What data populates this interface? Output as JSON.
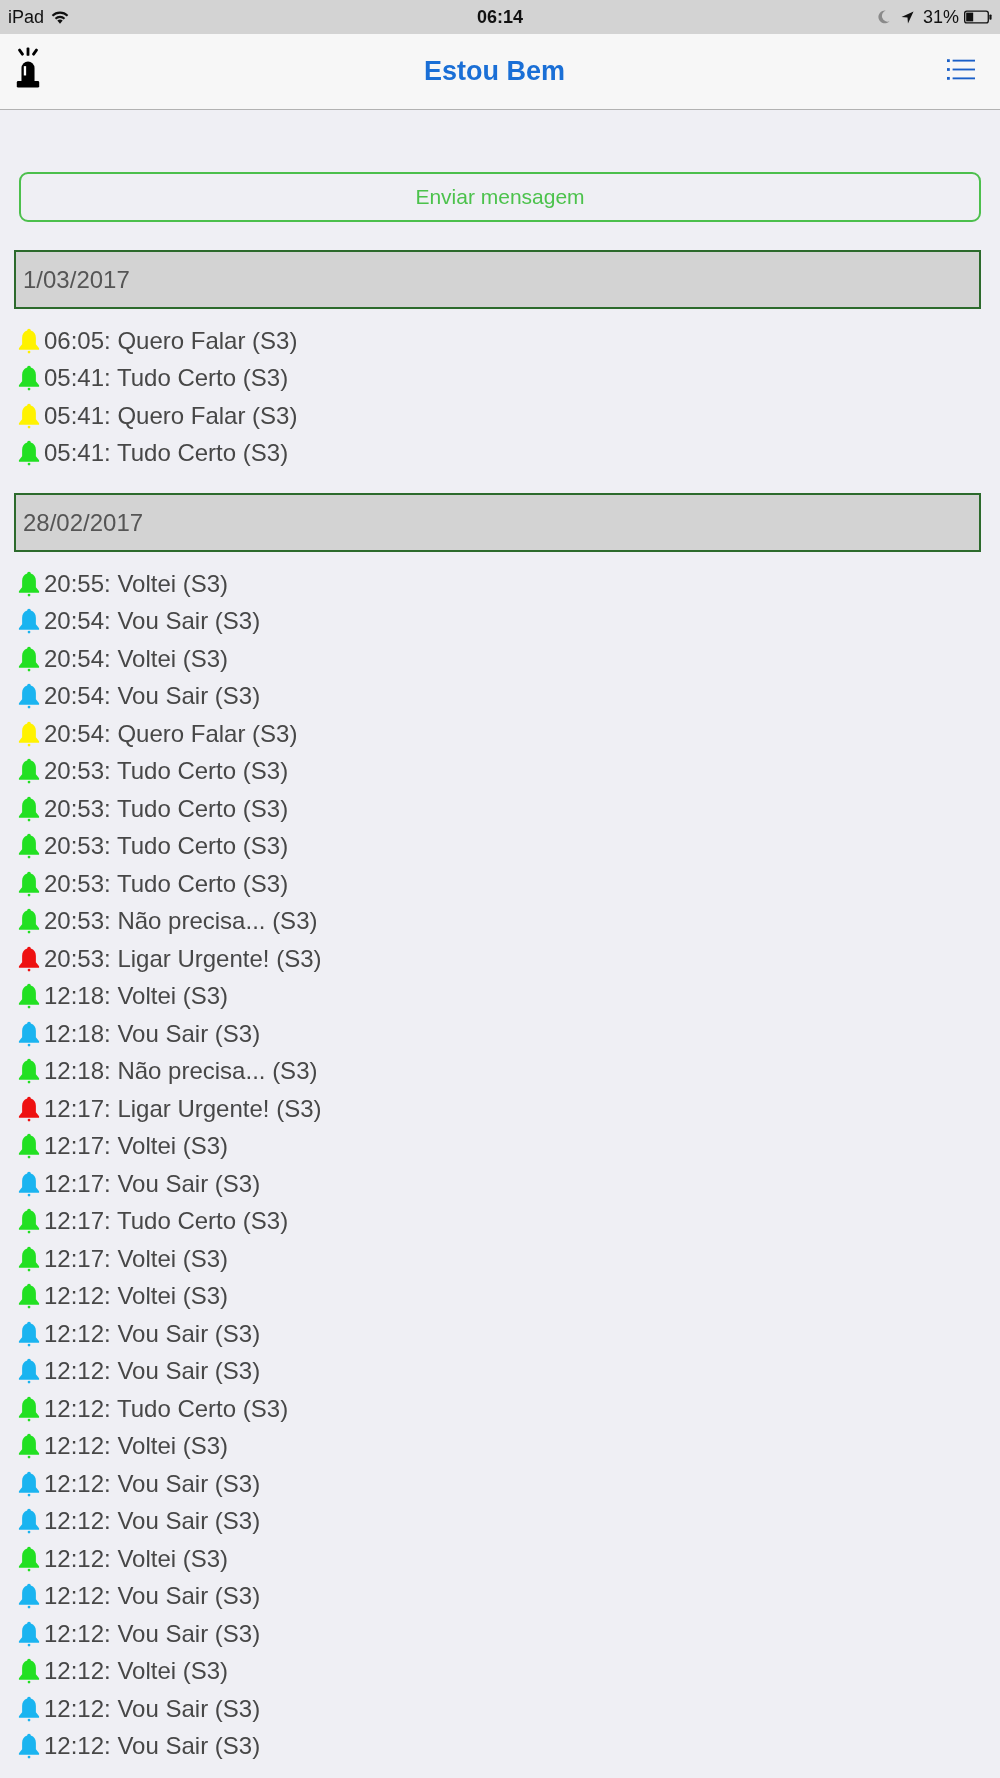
{
  "status_bar": {
    "device": "iPad",
    "time": "06:14",
    "battery": "31%"
  },
  "nav_bar": {
    "title": "Estou Bem"
  },
  "send_button": {
    "label": "Enviar mensagem"
  },
  "sections": [
    {
      "date": "1/03/2017",
      "items": [
        {
          "text": "06:05: Quero Falar (S3)",
          "color": "#fff200"
        },
        {
          "text": "05:41: Tudo Certo (S3)",
          "color": "#22e022"
        },
        {
          "text": "05:41: Quero Falar (S3)",
          "color": "#fff200"
        },
        {
          "text": "05:41: Tudo Certo (S3)",
          "color": "#22e022"
        }
      ]
    },
    {
      "date": "28/02/2017",
      "items": [
        {
          "text": "20:55: Voltei (S3)",
          "color": "#22e022"
        },
        {
          "text": "20:54: Vou Sair (S3)",
          "color": "#1ab4f0"
        },
        {
          "text": "20:54: Voltei (S3)",
          "color": "#22e022"
        },
        {
          "text": "20:54: Vou Sair (S3)",
          "color": "#1ab4f0"
        },
        {
          "text": "20:54: Quero Falar (S3)",
          "color": "#fff200"
        },
        {
          "text": "20:53: Tudo Certo (S3)",
          "color": "#22e022"
        },
        {
          "text": "20:53: Tudo Certo (S3)",
          "color": "#22e022"
        },
        {
          "text": "20:53: Tudo Certo (S3)",
          "color": "#22e022"
        },
        {
          "text": "20:53: Tudo Certo (S3)",
          "color": "#22e022"
        },
        {
          "text": "20:53: Não precisa... (S3)",
          "color": "#22e022"
        },
        {
          "text": "20:53: Ligar Urgente! (S3)",
          "color": "#ee1111"
        },
        {
          "text": "12:18: Voltei (S3)",
          "color": "#22e022"
        },
        {
          "text": "12:18: Vou Sair (S3)",
          "color": "#1ab4f0"
        },
        {
          "text": "12:18: Não precisa... (S3)",
          "color": "#22e022"
        },
        {
          "text": "12:17: Ligar Urgente! (S3)",
          "color": "#ee1111"
        },
        {
          "text": "12:17: Voltei (S3)",
          "color": "#22e022"
        },
        {
          "text": "12:17: Vou Sair (S3)",
          "color": "#1ab4f0"
        },
        {
          "text": "12:17: Tudo Certo (S3)",
          "color": "#22e022"
        },
        {
          "text": "12:17: Voltei (S3)",
          "color": "#22e022"
        },
        {
          "text": "12:12: Voltei (S3)",
          "color": "#22e022"
        },
        {
          "text": "12:12: Vou Sair (S3)",
          "color": "#1ab4f0"
        },
        {
          "text": "12:12: Vou Sair (S3)",
          "color": "#1ab4f0"
        },
        {
          "text": "12:12: Tudo Certo (S3)",
          "color": "#22e022"
        },
        {
          "text": "12:12: Voltei (S3)",
          "color": "#22e022"
        },
        {
          "text": "12:12: Vou Sair (S3)",
          "color": "#1ab4f0"
        },
        {
          "text": "12:12: Vou Sair (S3)",
          "color": "#1ab4f0"
        },
        {
          "text": "12:12: Voltei (S3)",
          "color": "#22e022"
        },
        {
          "text": "12:12: Vou Sair (S3)",
          "color": "#1ab4f0"
        },
        {
          "text": "12:12: Vou Sair (S3)",
          "color": "#1ab4f0"
        },
        {
          "text": "12:12: Voltei (S3)",
          "color": "#22e022"
        },
        {
          "text": "12:12: Vou Sair (S3)",
          "color": "#1ab4f0"
        },
        {
          "text": "12:12: Vou Sair (S3)",
          "color": "#1ab4f0"
        }
      ]
    }
  ]
}
